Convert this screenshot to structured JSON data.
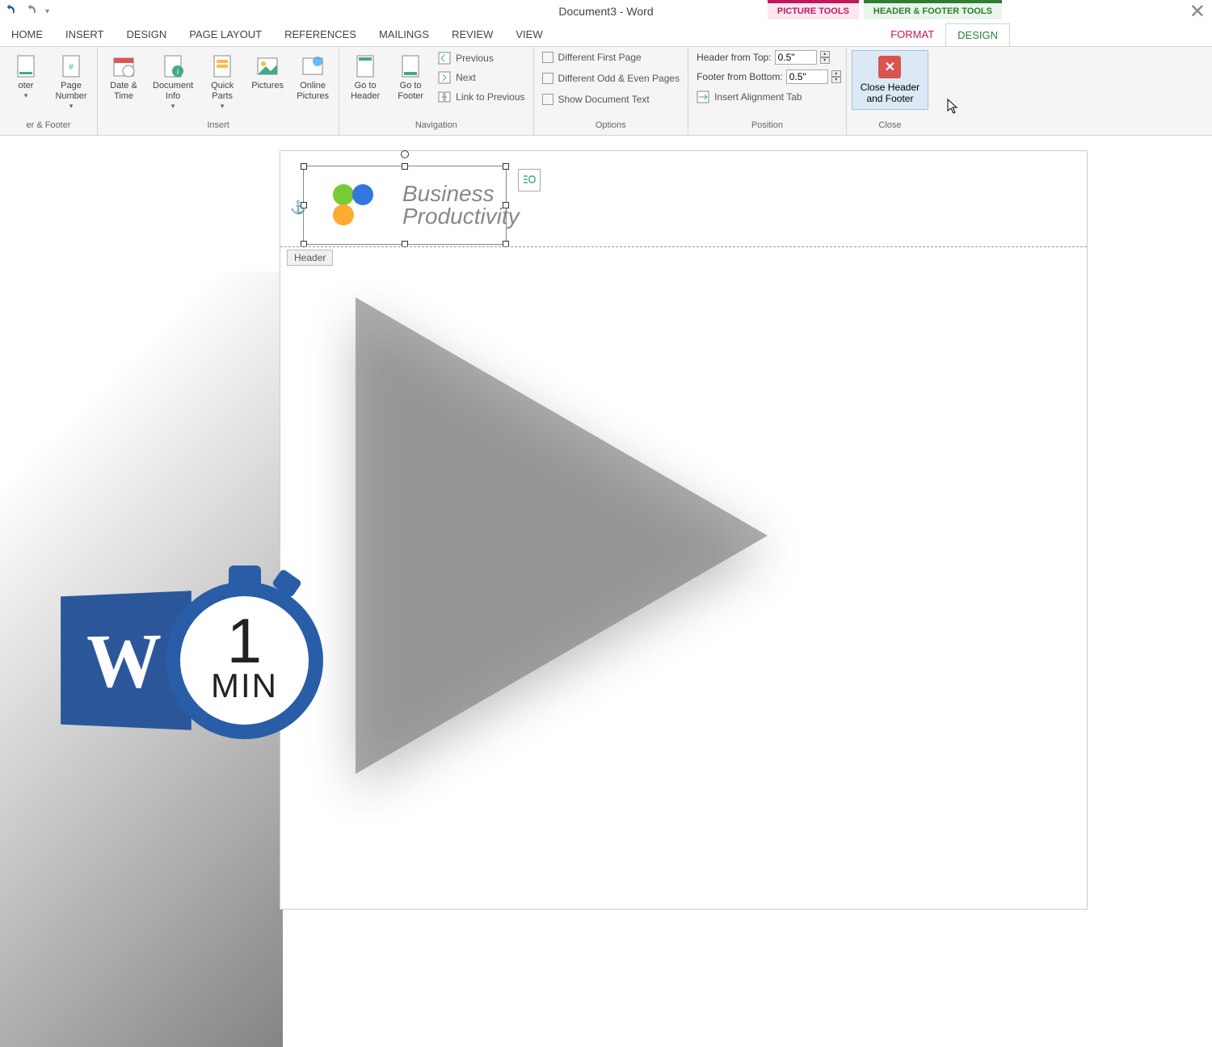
{
  "title": "Document3 - Word",
  "ctx_tabs": {
    "picture": "PICTURE TOOLS",
    "hf": "HEADER & FOOTER TOOLS"
  },
  "tabs": [
    "HOME",
    "INSERT",
    "DESIGN",
    "PAGE LAYOUT",
    "REFERENCES",
    "MAILINGS",
    "REVIEW",
    "VIEW"
  ],
  "ctx_sub": {
    "format": "FORMAT",
    "design": "DESIGN"
  },
  "groups": {
    "hf": {
      "label": "er & Footer",
      "footer": "oter",
      "page_no": "Page\nNumber"
    },
    "insert": {
      "label": "Insert",
      "date": "Date &\nTime",
      "docinfo": "Document\nInfo",
      "quick": "Quick\nParts",
      "pics": "Pictures",
      "online": "Online\nPictures"
    },
    "nav": {
      "label": "Navigation",
      "gohdr": "Go to\nHeader",
      "goftr": "Go to\nFooter",
      "prev": "Previous",
      "next": "Next",
      "link": "Link to Previous"
    },
    "opts": {
      "label": "Options",
      "diff1": "Different First Page",
      "diffoe": "Different Odd & Even Pages",
      "showdoc": "Show Document Text"
    },
    "pos": {
      "label": "Position",
      "htop": "Header from Top:",
      "fbot": "Footer from Bottom:",
      "align": "Insert Alignment Tab",
      "vtop": "0.5\"",
      "vbot": "0.5\""
    },
    "close": {
      "label": "Close",
      "btn": "Close Header\nand Footer"
    }
  },
  "doc": {
    "header_tag": "Header",
    "logo_line1": "Business",
    "logo_line2": "Productivity"
  },
  "badge": {
    "num": "1",
    "min": "MIN"
  }
}
